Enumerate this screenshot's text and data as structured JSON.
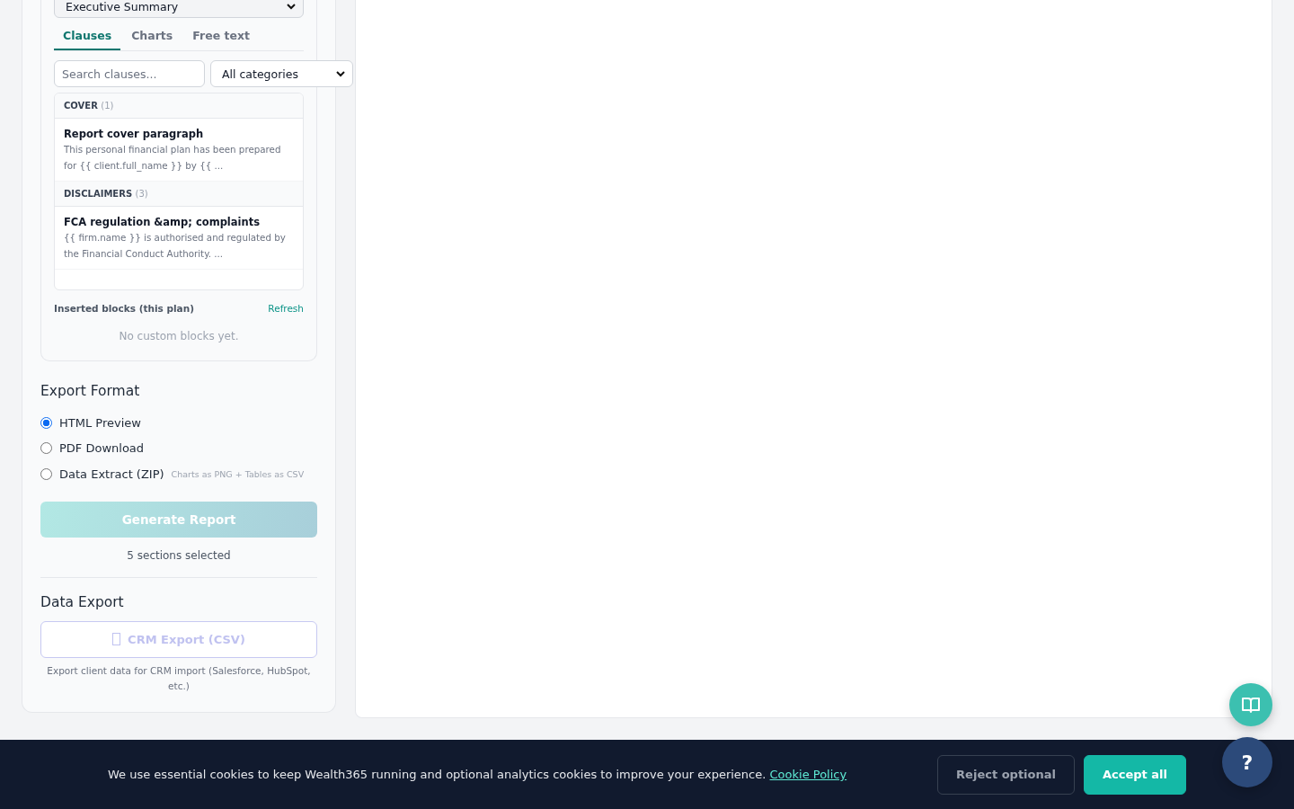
{
  "template_select": {
    "value": "Executive Summary"
  },
  "tabs": [
    {
      "label": "Clauses",
      "selected": true
    },
    {
      "label": "Charts",
      "selected": false
    },
    {
      "label": "Free text",
      "selected": false
    }
  ],
  "clause_search": {
    "placeholder": "Search clauses..."
  },
  "category_select": {
    "value": "All categories"
  },
  "clause_groups": [
    {
      "name": "COVER",
      "count": "(1)",
      "clauses": [
        {
          "title": "Report cover paragraph",
          "preview": "This personal financial plan has been prepared for {{ client.full_name }} by {{ ..."
        }
      ]
    },
    {
      "name": "DISCLAIMERS",
      "count": "(3)",
      "clauses": [
        {
          "title": "FCA regulation &amp; complaints",
          "preview": "{{ firm.name }} is authorised and regulated by the Financial Conduct Authority. ..."
        }
      ]
    }
  ],
  "inserted_blocks": {
    "title": "Inserted blocks (this plan)",
    "action": "Refresh",
    "empty": "No custom blocks yet."
  },
  "export_format": {
    "title": "Export Format",
    "options": [
      {
        "label": "HTML Preview",
        "selected": true
      },
      {
        "label": "PDF Download",
        "selected": false
      },
      {
        "label": "Data Extract (ZIP)",
        "hint": "Charts as PNG + Tables as CSV",
        "selected": false
      }
    ],
    "button": {
      "label": "Generate Report",
      "disabled": true
    },
    "status": "5 sections selected"
  },
  "data_export": {
    "title": "Data Export",
    "button": {
      "label": "CRM Export (CSV)",
      "disabled": true
    },
    "note": "Export client data for CRM import (Salesforce, HubSpot, etc.)"
  },
  "cookie_banner": {
    "text": "We use essential cookies to keep Wealth365 running and optional analytics cookies to improve your experience.",
    "link": "Cookie Policy",
    "buttons": [
      {
        "label": "Reject optional",
        "kind": "secondary"
      },
      {
        "label": "Accept all",
        "kind": "primary"
      }
    ]
  },
  "help_button": {
    "label": "?"
  }
}
